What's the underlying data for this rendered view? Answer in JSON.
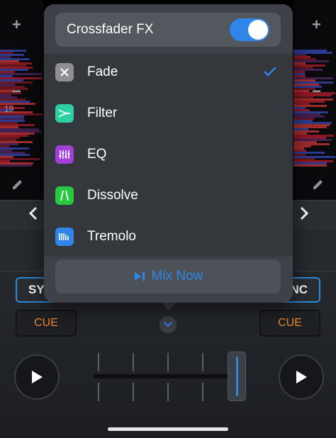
{
  "deck": {
    "left_plus": "+",
    "left_minus": "−",
    "right_plus": "+",
    "right_minus": "−",
    "track_number": "19",
    "sync_left_label": "SY",
    "sync_right_label": "NC",
    "cue_left_label": "CUE",
    "cue_right_label": "CUE"
  },
  "popover": {
    "toggle": {
      "label": "Crossfader FX",
      "on": true
    },
    "items": [
      {
        "label": "Fade",
        "icon": "fade-x-icon",
        "color": "#8e8e93",
        "selected": true
      },
      {
        "label": "Filter",
        "icon": "filter-icon",
        "color": "#2ecfa3",
        "selected": false
      },
      {
        "label": "EQ",
        "icon": "eq-sliders-icon",
        "color": "#a23fd6",
        "selected": false
      },
      {
        "label": "Dissolve",
        "icon": "dissolve-icon",
        "color": "#27c93f",
        "selected": false
      },
      {
        "label": "Tremolo",
        "icon": "tremolo-icon",
        "color": "#2f86e8",
        "selected": false
      }
    ],
    "mix_now_label": "Mix Now"
  },
  "colors": {
    "accent": "#2f86e8",
    "cue": "#e8892e",
    "sync_border": "#2d8bd8"
  }
}
